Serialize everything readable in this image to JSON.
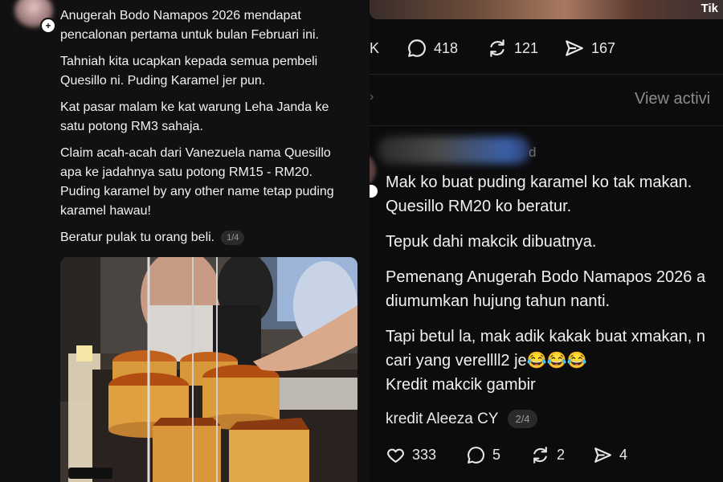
{
  "left_post": {
    "paragraphs": [
      "Anugerah Bodo Namapos 2026 mendapat\npencalonan pertama untuk bulan Februari ini.",
      "Tahniah kita ucapkan kepada semua pembeli\nQuesillo ni. Puding Karamel jer pun.",
      "Kat pasar malam ke kat warung Leha Janda ke\nsatu potong RM3 sahaja.",
      "Claim acah-acah dari Vanezuela nama Quesillo\napa ke jadahnya satu potong RM15 - RM20.\nPuding karamel by any other name tetap puding\nkaramel hawau!"
    ],
    "last_line": "Beratur pulak tu orang beli.",
    "page_indicator": "1/4"
  },
  "right_post": {
    "watermark": "Tik",
    "stats": {
      "likes_partial": "K",
      "comments": "418",
      "reposts": "121",
      "shares": "167"
    },
    "view_activity": "View activi",
    "reply": {
      "time": "d",
      "paragraphs": [
        "Mak ko buat puding karamel ko tak makan.\nQuesillo RM20 ko beratur.",
        "Tepuk dahi makcik dibuatnya.",
        "Pemenang Anugerah Bodo Namapos 2026 a\ndiumumkan hujung tahun nanti.",
        "Tapi betul la, mak adik kakak buat xmakan, n\ncari yang verellll2 je😂😂😂\nKredit makcik gambir"
      ],
      "credit": "kredit Aleeza CY",
      "page_indicator": "2/4",
      "stats": {
        "likes": "333",
        "comments": "5",
        "reposts": "2",
        "shares": "4"
      }
    }
  }
}
